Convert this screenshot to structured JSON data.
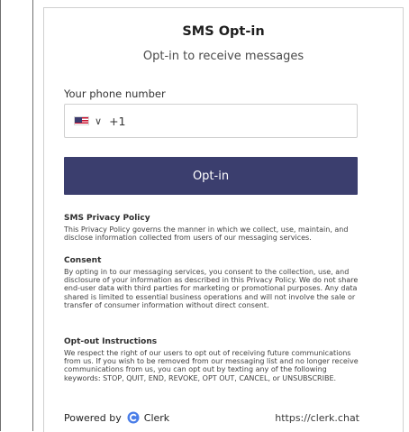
{
  "form": {
    "title": "SMS Opt-in",
    "subtitle": "Opt-in to receive messages",
    "phone_label": "Your phone number",
    "country_code": "+1",
    "button_label": "Opt-in"
  },
  "sections": [
    {
      "title": "SMS Privacy Policy",
      "body": "This Privacy Policy governs the manner in which we collect, use, maintain, and disclose information collected from users of our messaging services."
    },
    {
      "title": "Consent",
      "body": "By opting in to our messaging services, you consent to the collection, use, and disclosure of your information as described in this Privacy Policy. We do not share end-user data with third parties for marketing or promotional purposes. Any data shared is limited to essential business operations and will not involve the sale or transfer of consumer information without direct consent."
    },
    {
      "title": "Opt-out Instructions",
      "body": "We respect the right of our users to opt out of receiving future communications from us. If you wish to be removed from our messaging list and no longer receive communications from us, you can opt out by texting any of the following keywords: STOP, QUIT, END, REVOKE, OPT OUT, CANCEL, or UNSUBSCRIBE."
    }
  ],
  "footer": {
    "powered_by": "Powered by",
    "brand": "Clerk",
    "url": "https://clerk.chat"
  },
  "icons": {
    "flag": "us-flag-icon",
    "chevron": "chevron-down-icon",
    "logo": "clerk-logo-icon"
  },
  "colors": {
    "button_bg": "#3b3e6e",
    "logo_blue": "#4a7ee8"
  }
}
